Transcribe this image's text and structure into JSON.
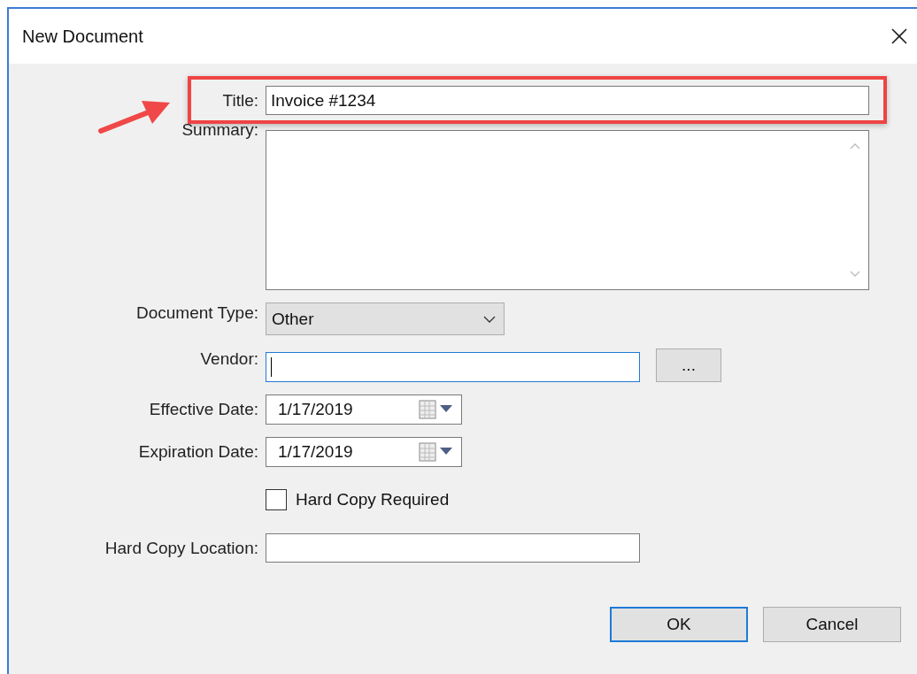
{
  "window": {
    "title": "New Document"
  },
  "form": {
    "title": {
      "label": "Title:",
      "value": "Invoice #1234"
    },
    "summary": {
      "label": "Summary:"
    },
    "document_type": {
      "label": "Document Type:",
      "value": "Other"
    },
    "vendor": {
      "label": "Vendor:",
      "focused": true,
      "browse_button": "..."
    },
    "effective_date": {
      "label": "Effective Date:",
      "value": "1/17/2019"
    },
    "expiration_date": {
      "label": "Expiration Date:",
      "value": "1/17/2019"
    },
    "hard_copy_required": {
      "label": "Hard Copy Required",
      "checked": false
    },
    "hard_copy_location": {
      "label": "Hard Copy Location:"
    }
  },
  "buttons": [
    {
      "label": "OK",
      "default": true
    },
    {
      "label": "Cancel",
      "default": false
    }
  ]
}
